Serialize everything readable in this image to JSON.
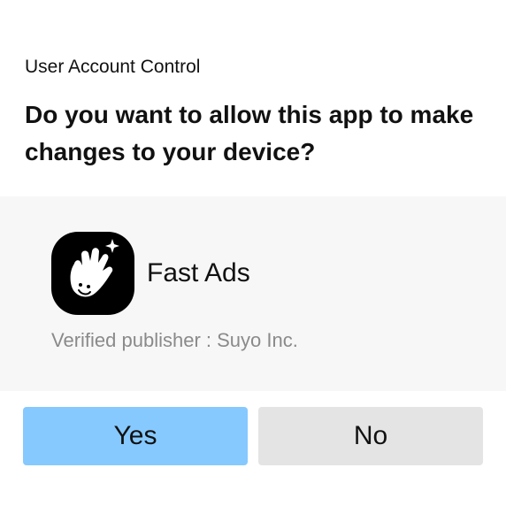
{
  "dialog": {
    "caption": "User Account Control",
    "question": "Do you want to allow this app to make changes to your device?"
  },
  "app": {
    "icon": "waving-hand-app-icon",
    "name": "Fast Ads",
    "publisher": "Verified publisher : Suyo Inc."
  },
  "buttons": {
    "yes_label": "Yes",
    "no_label": "No"
  },
  "colors": {
    "yes_button": "#86c9ff",
    "no_button": "#e4e4e4",
    "app_panel": "#f7f7f7",
    "icon_background": "#000000"
  }
}
